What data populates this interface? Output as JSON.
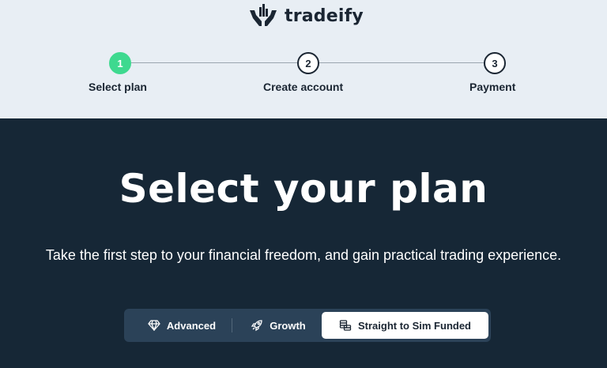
{
  "brand": {
    "name": "tradeify",
    "logo_icon": "hands-holding-bars-icon"
  },
  "stepper": {
    "steps": [
      {
        "number": "1",
        "label": "Select plan",
        "state": "active"
      },
      {
        "number": "2",
        "label": "Create account",
        "state": "upcoming"
      },
      {
        "number": "3",
        "label": "Payment",
        "state": "upcoming"
      }
    ]
  },
  "hero": {
    "title": "Select your plan",
    "subtitle": "Take the first step to your financial freedom, and gain practical trading experience."
  },
  "plan_tabs": {
    "items": [
      {
        "label": "Advanced",
        "icon": "diamond-icon",
        "selected": false
      },
      {
        "label": "Growth",
        "icon": "rocket-icon",
        "selected": false
      },
      {
        "label": "Straight to Sim Funded",
        "icon": "coins-stack-icon",
        "selected": true
      }
    ]
  },
  "colors": {
    "header_bg": "#e8eef4",
    "page_bg": "#162736",
    "accent_green": "#3ed98f",
    "tab_bar_bg": "#2b4258",
    "text_dark": "#1b2633"
  }
}
